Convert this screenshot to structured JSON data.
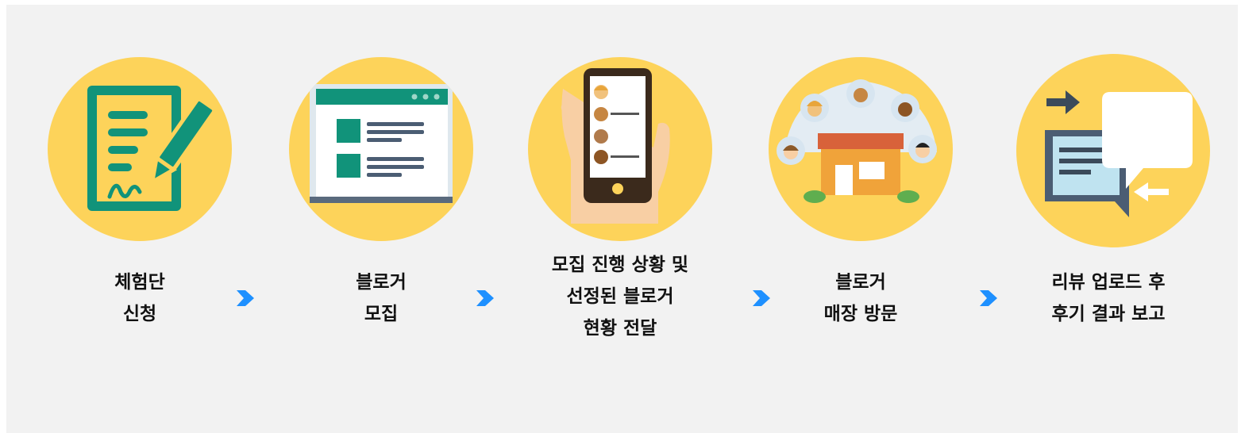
{
  "steps": [
    {
      "icon": "application-form-icon",
      "lines": [
        "체험단",
        "신청"
      ]
    },
    {
      "icon": "webpage-listing-icon",
      "lines": [
        "블로거",
        "모집"
      ]
    },
    {
      "icon": "smartphone-contacts-icon",
      "lines": [
        "모집 진행 상황 및",
        "선정된 블로거",
        "현황 전달"
      ]
    },
    {
      "icon": "store-visitors-icon",
      "lines": [
        "블로거",
        "매장 방문"
      ]
    },
    {
      "icon": "chat-exchange-icon",
      "lines": [
        "리뷰 업로드 후",
        "후기 결과 보고"
      ]
    }
  ],
  "colors": {
    "circle": "#fdd35a",
    "arrow": "#1e90ff",
    "teal": "#11937a",
    "background": "#f2f2f2"
  }
}
